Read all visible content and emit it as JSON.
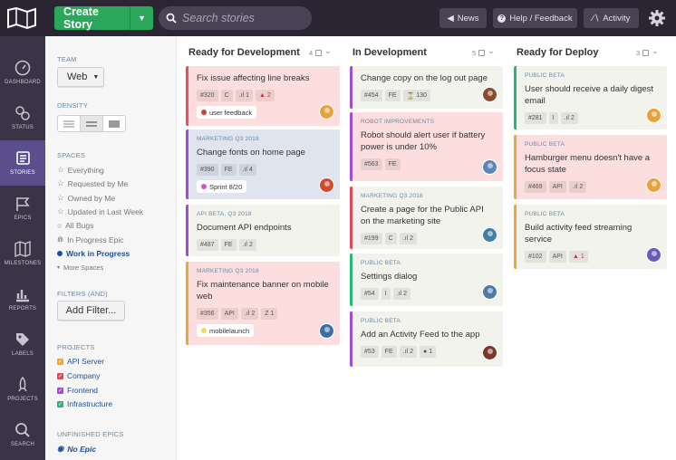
{
  "topbar": {
    "create_label": "Create Story",
    "search_placeholder": "Search stories",
    "news_label": "News",
    "help_label": "Help / Feedback",
    "activity_label": "Activity"
  },
  "sidebar": [
    {
      "label": "DASHBOARD",
      "icon": "gauge-icon"
    },
    {
      "label": "STATUS",
      "icon": "status-icon"
    },
    {
      "label": "STORIES",
      "icon": "stories-icon",
      "active": true
    },
    {
      "label": "EPICS",
      "icon": "flag-icon"
    },
    {
      "label": "MILESTONES",
      "icon": "map-icon"
    },
    {
      "label": "REPORTS",
      "icon": "chart-icon"
    },
    {
      "label": "LABELS",
      "icon": "tag-icon"
    },
    {
      "label": "PROJECTS",
      "icon": "rocket-icon"
    },
    {
      "label": "SEARCH",
      "icon": "search-icon"
    }
  ],
  "panel": {
    "team_heading": "TEAM",
    "team_value": "Web",
    "density_heading": "DENSITY",
    "spaces_heading": "SPACES",
    "spaces": [
      "Everything",
      "Requested by Me",
      "Owned by Me",
      "Updated in Last Week",
      "All Bugs",
      "In Progress Epic",
      "Work in Progress",
      "More Spaces"
    ],
    "filters_heading": "FILTERS (AND)",
    "add_filter_label": "Add Filter...",
    "projects_heading": "PROJECTS",
    "projects": [
      {
        "name": "API Server",
        "color": "#e9a93a"
      },
      {
        "name": "Company",
        "color": "#dd4b5b"
      },
      {
        "name": "Frontend",
        "color": "#a04ecf"
      },
      {
        "name": "Infrastructure",
        "color": "#2bb673"
      }
    ],
    "epics_heading": "UNFINISHED EPICS",
    "no_epic_label": "No Epic"
  },
  "columns": [
    {
      "title": "Ready for Development",
      "count": "4",
      "cards": [
        {
          "epic": "",
          "title": "Fix issue affecting line breaks",
          "id": "#320",
          "proj": "C",
          "est": "1",
          "extra": "2",
          "tag": "user feedback",
          "tag_color": "#d43c3c",
          "bg": "#fcdede",
          "border": "#e8505b",
          "avatar": "#e8a23c"
        },
        {
          "epic": "MARKETING Q3 2018",
          "title": "Change fonts on home page",
          "id": "#390",
          "proj": "FE",
          "est": "4",
          "tag": "Sprint 8/20",
          "tag_color": "#d455c8",
          "bg": "#dfe4ee",
          "border": "#a04ecf",
          "avatar": "#d04a2e"
        },
        {
          "epic": "API BETA, Q3 2018",
          "title": "Document API endpoints",
          "id": "#487",
          "proj": "FE",
          "est": "2",
          "bg": "#f3f3ee",
          "border": "#a04ecf"
        },
        {
          "epic": "MARKETING Q3 2018",
          "title": "Fix maintenance banner on mobile web",
          "id": "#356",
          "proj": "API",
          "est": "2",
          "extra": "1",
          "tag": "mobilelaunch",
          "tag_color": "#f2d860",
          "bg": "#fcdede",
          "border": "#e9a93a",
          "avatar": "#3d6fa5"
        }
      ]
    },
    {
      "title": "In Development",
      "count": "5",
      "cards": [
        {
          "epic": "",
          "title": "Change copy on the log out page",
          "id": "#454",
          "proj": "FE",
          "est": "130",
          "bg": "#f3f3ee",
          "border": "#a04ecf",
          "avatar": "#8a4a2c"
        },
        {
          "epic": "ROBOT IMPROVEMENTS",
          "title": "Robot should alert user if battery power is under 10%",
          "id": "#563",
          "proj": "FE",
          "bg": "#fcdede",
          "border": "#a04ecf",
          "avatar": "#5a86b8"
        },
        {
          "epic": "MARKETING Q3 2018",
          "title": "Create a page for the Public API on the marketing site",
          "id": "#199",
          "proj": "C",
          "est": "2",
          "bg": "#f3f3ee",
          "border": "#dd4b5b",
          "avatar": "#3f7fa8"
        },
        {
          "epic": "PUBLIC BETA",
          "title": "Settings dialog",
          "id": "#54",
          "proj": "I",
          "est": "2",
          "bg": "#f3f3ee",
          "border": "#2bb673",
          "avatar": "#4a7ca6"
        },
        {
          "epic": "PUBLIC BETA",
          "title": "Add an Activity Feed to the app",
          "id": "#53",
          "proj": "FE",
          "est": "2",
          "extra": "1",
          "bg": "#f3f3ee",
          "border": "#a04ecf",
          "avatar": "#7a3a2a"
        }
      ]
    },
    {
      "title": "Ready for Deploy",
      "count": "3",
      "cards": [
        {
          "epic": "PUBLIC BETA",
          "title": "User should receive a daily digest email",
          "id": "#281",
          "proj": "I",
          "est": "2",
          "bg": "#f3f3ee",
          "border": "#2bb673",
          "avatar": "#e8a23c"
        },
        {
          "epic": "PUBLIC BETA",
          "title": "Hamburger menu doesn't have a focus state",
          "id": "#469",
          "proj": "API",
          "est": "2",
          "bg": "#fcdede",
          "border": "#e9a93a",
          "avatar": "#e8a23c"
        },
        {
          "epic": "PUBLIC BETA",
          "title": "Build activity feed streaming service",
          "id": "#102",
          "proj": "API",
          "extra": "1",
          "bg": "#f3f3ee",
          "border": "#e9a93a",
          "avatar": "#6a5ab8"
        }
      ]
    }
  ]
}
